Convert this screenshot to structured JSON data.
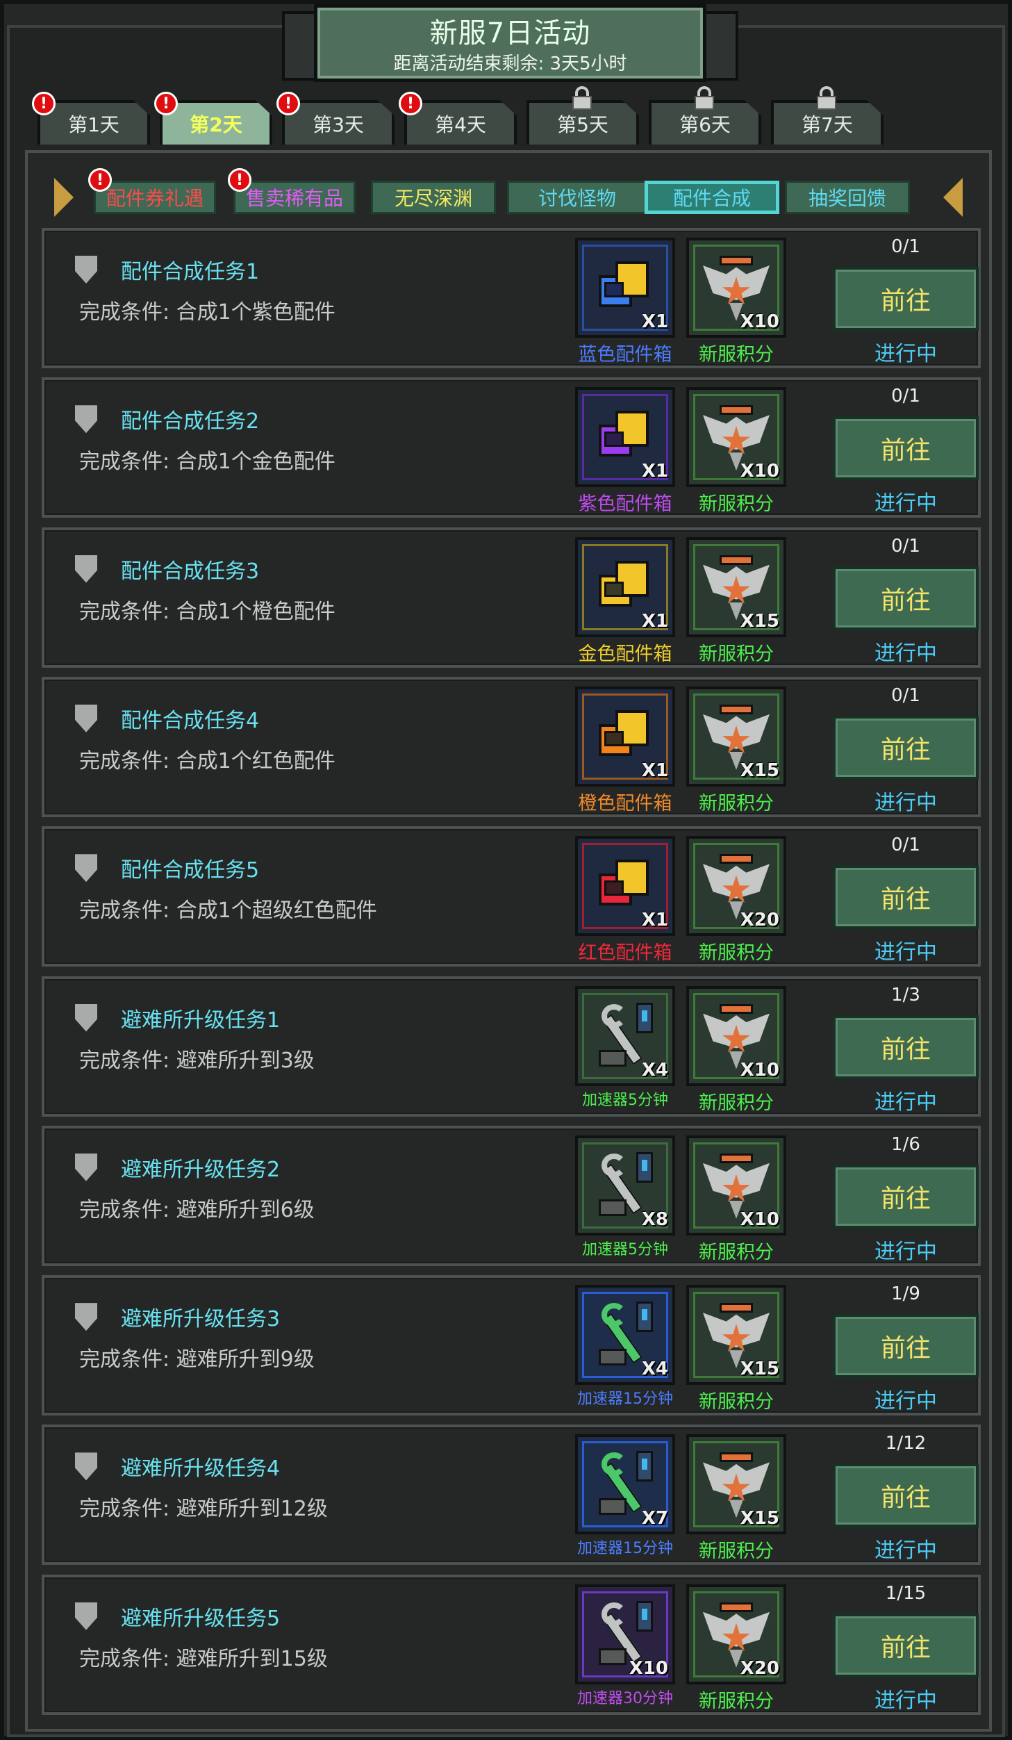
{
  "header": {
    "title": "新服7日活动",
    "countdown": "距离活动结束剩余: 3天5小时"
  },
  "day_tabs": [
    {
      "label": "第1天",
      "alert": true,
      "locked": false,
      "active": false
    },
    {
      "label": "第2天",
      "alert": true,
      "locked": false,
      "active": true
    },
    {
      "label": "第3天",
      "alert": true,
      "locked": false,
      "active": false
    },
    {
      "label": "第4天",
      "alert": true,
      "locked": false,
      "active": false
    },
    {
      "label": "第5天",
      "alert": false,
      "locked": true,
      "active": false
    },
    {
      "label": "第6天",
      "alert": false,
      "locked": true,
      "active": false
    },
    {
      "label": "第7天",
      "alert": false,
      "locked": true,
      "active": false
    }
  ],
  "alert_mark": "!",
  "sub_tabs": [
    {
      "label": "配件券礼遇",
      "color": "#ff4a4a",
      "alert": true,
      "active": false
    },
    {
      "label": "售卖稀有品",
      "color": "#e05cf2",
      "alert": true,
      "active": false
    },
    {
      "label": "无尽深渊",
      "color": "#f5e860",
      "alert": false,
      "active": false
    },
    {
      "label": "讨伐怪物",
      "color": "#5fd9f2",
      "alert": false,
      "active": false
    },
    {
      "label": "配件合成",
      "color": "#5fd9f2",
      "alert": false,
      "active": true
    },
    {
      "label": "抽奖回馈",
      "color": "#5fd9f2",
      "alert": false,
      "active": false
    }
  ],
  "go_label": "前往",
  "status_label": "进行中",
  "points_label": "新服积分",
  "tasks": [
    {
      "name": "配件合成任务1",
      "condition": "完成条件: 合成1个紫色配件",
      "progress": "0/1",
      "reward1": {
        "name": "蓝色配件箱",
        "qty": "X1",
        "color": "#4c7cff",
        "icon": "blue-crate-icon"
      },
      "reward2_qty": "X10"
    },
    {
      "name": "配件合成任务2",
      "condition": "完成条件: 合成1个金色配件",
      "progress": "0/1",
      "reward1": {
        "name": "紫色配件箱",
        "qty": "X1",
        "color": "#c04cf0",
        "icon": "purple-crate-icon"
      },
      "reward2_qty": "X10"
    },
    {
      "name": "配件合成任务3",
      "condition": "完成条件: 合成1个橙色配件",
      "progress": "0/1",
      "reward1": {
        "name": "金色配件箱",
        "qty": "X1",
        "color": "#f2d02a",
        "icon": "gold-crate-icon"
      },
      "reward2_qty": "X15"
    },
    {
      "name": "配件合成任务4",
      "condition": "完成条件: 合成1个红色配件",
      "progress": "0/1",
      "reward1": {
        "name": "橙色配件箱",
        "qty": "X1",
        "color": "#f28a2a",
        "icon": "orange-crate-icon"
      },
      "reward2_qty": "X15"
    },
    {
      "name": "配件合成任务5",
      "condition": "完成条件: 合成1个超级红色配件",
      "progress": "0/1",
      "reward1": {
        "name": "红色配件箱",
        "qty": "X1",
        "color": "#f2283a",
        "icon": "red-crate-icon"
      },
      "reward2_qty": "X20"
    },
    {
      "name": "避难所升级任务1",
      "condition": "完成条件: 避难所升到3级",
      "progress": "1/3",
      "reward1": {
        "name": "加速器5分钟",
        "qty": "X4",
        "color": "#4cf04c",
        "icon": "accelerator-icon"
      },
      "reward2_qty": "X10"
    },
    {
      "name": "避难所升级任务2",
      "condition": "完成条件: 避难所升到6级",
      "progress": "1/6",
      "reward1": {
        "name": "加速器5分钟",
        "qty": "X8",
        "color": "#4cf04c",
        "icon": "accelerator-icon"
      },
      "reward2_qty": "X10"
    },
    {
      "name": "避难所升级任务3",
      "condition": "完成条件: 避难所升到9级",
      "progress": "1/9",
      "reward1": {
        "name": "加速器15分钟",
        "qty": "X4",
        "color": "#4c7cff",
        "icon": "accelerator-icon"
      },
      "reward2_qty": "X15"
    },
    {
      "name": "避难所升级任务4",
      "condition": "完成条件: 避难所升到12级",
      "progress": "1/12",
      "reward1": {
        "name": "加速器15分钟",
        "qty": "X7",
        "color": "#4c7cff",
        "icon": "accelerator-icon"
      },
      "reward2_qty": "X15"
    },
    {
      "name": "避难所升级任务5",
      "condition": "完成条件: 避难所升到15级",
      "progress": "1/15",
      "reward1": {
        "name": "加速器30分钟",
        "qty": "X10",
        "color": "#c04cf0",
        "icon": "accelerator-icon"
      },
      "reward2_qty": "X20"
    }
  ]
}
